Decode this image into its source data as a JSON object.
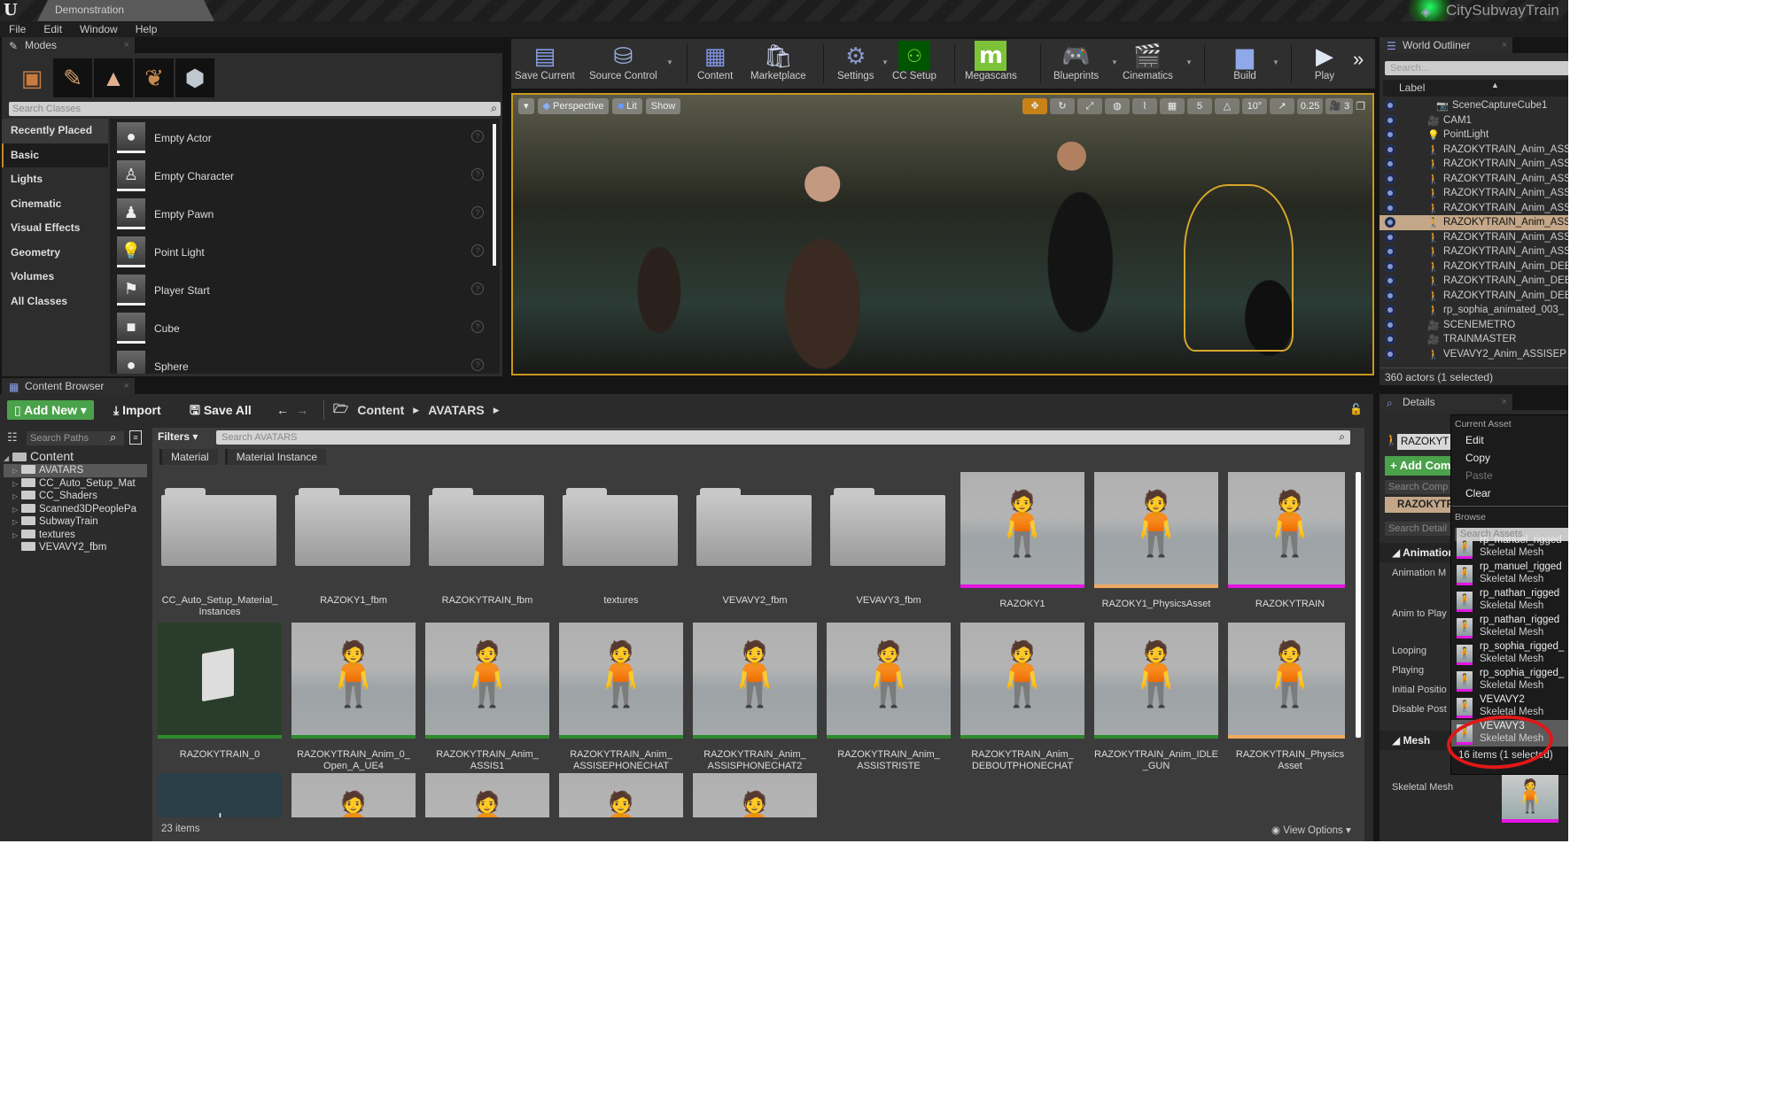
{
  "window": {
    "logo": "U",
    "doc_tab": "Demonstration",
    "project_name": "CitySubwayTrain"
  },
  "menubar": [
    "File",
    "Edit",
    "Window",
    "Help"
  ],
  "modes": {
    "tab_label": "Modes",
    "mode_icons": [
      "place-mode-icon",
      "paint-mode-icon",
      "landscape-mode-icon",
      "foliage-mode-icon",
      "geometry-mode-icon"
    ],
    "search_placeholder": "Search Classes",
    "categories": [
      "Recently Placed",
      "Basic",
      "Lights",
      "Cinematic",
      "Visual Effects",
      "Geometry",
      "Volumes",
      "All Classes"
    ],
    "active_category": "Basic",
    "items": [
      {
        "label": "Empty Actor",
        "icon": "●"
      },
      {
        "label": "Empty Character",
        "icon": "♙"
      },
      {
        "label": "Empty Pawn",
        "icon": "♟"
      },
      {
        "label": "Point Light",
        "icon": "💡"
      },
      {
        "label": "Player Start",
        "icon": "⚑"
      },
      {
        "label": "Cube",
        "icon": "■"
      },
      {
        "label": "Sphere",
        "icon": "●"
      }
    ]
  },
  "toolbar": {
    "buttons": [
      {
        "label": "Save Current",
        "icon": "💾"
      },
      {
        "label": "Source Control",
        "icon": "🗂"
      },
      {
        "label": "Content",
        "icon": "▦"
      },
      {
        "label": "Marketplace",
        "icon": "🛍"
      },
      {
        "label": "Settings",
        "icon": "⚙"
      },
      {
        "label": "CC Setup",
        "icon": "👥"
      },
      {
        "label": "Megascans",
        "icon": "m"
      },
      {
        "label": "Blueprints",
        "icon": "🎮"
      },
      {
        "label": "Cinematics",
        "icon": "🎬"
      },
      {
        "label": "Build",
        "icon": "▆"
      },
      {
        "label": "Play",
        "icon": "▶"
      }
    ],
    "overflow": "»"
  },
  "viewport": {
    "menu_arrow": "▾",
    "view_mode": "Perspective",
    "lighting": "Lit",
    "show": "Show",
    "grid_snap": "5",
    "rotation_snap": "10°",
    "scale_snap": "0.25",
    "camera_speed": "3"
  },
  "outliner": {
    "tab_label": "World Outliner",
    "search_placeholder": "Search...",
    "column_label": "Label",
    "rows": [
      {
        "label": "SceneCaptureCube1",
        "icon": "📷",
        "indent": true
      },
      {
        "label": "CAM1",
        "icon": "🎥"
      },
      {
        "label": "PointLight",
        "icon": "💡"
      },
      {
        "label": "RAZOKYTRAIN_Anim_ASS",
        "icon": "🚶"
      },
      {
        "label": "RAZOKYTRAIN_Anim_ASS",
        "icon": "🚶"
      },
      {
        "label": "RAZOKYTRAIN_Anim_ASS",
        "icon": "🚶"
      },
      {
        "label": "RAZOKYTRAIN_Anim_ASS",
        "icon": "🚶"
      },
      {
        "label": "RAZOKYTRAIN_Anim_ASS",
        "icon": "🚶"
      },
      {
        "label": "RAZOKYTRAIN_Anim_ASS",
        "icon": "🚶",
        "selected": true
      },
      {
        "label": "RAZOKYTRAIN_Anim_ASS",
        "icon": "🚶"
      },
      {
        "label": "RAZOKYTRAIN_Anim_ASS",
        "icon": "🚶"
      },
      {
        "label": "RAZOKYTRAIN_Anim_DEE",
        "icon": "🚶"
      },
      {
        "label": "RAZOKYTRAIN_Anim_DEE",
        "icon": "🚶"
      },
      {
        "label": "RAZOKYTRAIN_Anim_DEE",
        "icon": "🚶"
      },
      {
        "label": "rp_sophia_animated_003_",
        "icon": "🚶"
      },
      {
        "label": "SCENEMETRO",
        "icon": "🎥"
      },
      {
        "label": "TRAINMASTER",
        "icon": "🎥"
      },
      {
        "label": "VEVAVY2_Anim_ASSISEP",
        "icon": "🚶"
      }
    ],
    "status": "360 actors (1 selected)"
  },
  "content_browser": {
    "tab_label": "Content Browser",
    "add_new": "Add New ▾",
    "import": "Import",
    "save_all": "Save All",
    "breadcrumb": [
      "Content",
      "AVATARS"
    ],
    "paths_search_placeholder": "Search Paths",
    "tree": {
      "root": "Content",
      "children": [
        "AVATARS",
        "CC_Auto_Setup_Mat",
        "CC_Shaders",
        "Scanned3DPeoplePa",
        "SubwayTrain",
        "textures",
        "VEVAVY2_fbm"
      ],
      "selected": "AVATARS"
    },
    "filters_label": "Filters ▾",
    "search_placeholder": "Search AVATARS",
    "filter_tags": [
      "Material",
      "Material Instance"
    ],
    "assets": [
      {
        "name": "CC_Auto_Setup_Material_ Instances",
        "kind": "folder"
      },
      {
        "name": "RAZOKY1_fbm",
        "kind": "folder"
      },
      {
        "name": "RAZOKYTRAIN_fbm",
        "kind": "folder"
      },
      {
        "name": "textures",
        "kind": "folder"
      },
      {
        "name": "VEVAVY2_fbm",
        "kind": "folder"
      },
      {
        "name": "VEVAVY3_fbm",
        "kind": "folder"
      },
      {
        "name": "RAZOKY1",
        "kind": "mesh",
        "bar": "magenta"
      },
      {
        "name": "RAZOKY1_PhysicsAsset",
        "kind": "mesh",
        "bar": "orange"
      },
      {
        "name": "RAZOKYTRAIN",
        "kind": "mesh",
        "bar": "magenta"
      },
      {
        "name": "RAZOKYTRAIN_0",
        "kind": "material",
        "bar": "green"
      },
      {
        "name": "RAZOKYTRAIN_Anim_0_ Open_A_UE4",
        "kind": "mesh",
        "bar": "green"
      },
      {
        "name": "RAZOKYTRAIN_Anim_ ASSIS1",
        "kind": "mesh",
        "bar": "green"
      },
      {
        "name": "RAZOKYTRAIN_Anim_ ASSISEPHONECHAT",
        "kind": "mesh",
        "bar": "green"
      },
      {
        "name": "RAZOKYTRAIN_Anim_ ASSISPHONECHAT2",
        "kind": "mesh",
        "bar": "green"
      },
      {
        "name": "RAZOKYTRAIN_Anim_ ASSISTRISTE",
        "kind": "mesh",
        "bar": "green"
      },
      {
        "name": "RAZOKYTRAIN_Anim_ DEBOUTPHONECHAT",
        "kind": "mesh",
        "bar": "green"
      },
      {
        "name": "RAZOKYTRAIN_Anim_IDLE _GUN",
        "kind": "mesh",
        "bar": "green"
      },
      {
        "name": "RAZOKYTRAIN_Physics Asset",
        "kind": "mesh",
        "bar": "orange"
      },
      {
        "name": "",
        "kind": "skeleton"
      },
      {
        "name": "",
        "kind": "mesh",
        "female": true
      },
      {
        "name": "",
        "kind": "mesh",
        "female": true
      },
      {
        "name": "",
        "kind": "mesh",
        "female": true
      },
      {
        "name": "",
        "kind": "mesh",
        "female": true
      }
    ],
    "status": "23 items",
    "view_options": "View Options ▾"
  },
  "details": {
    "tab_label": "Details",
    "actor_name": "RAZOKYT",
    "add_component": "+ Add Com",
    "search_components_placeholder": "Search Comp",
    "component": "RAZOKYTR",
    "search_details_placeholder": "Search Detail",
    "categories": [
      {
        "label": "Animation",
        "props": [
          "Animation M",
          "Anim to Play",
          "Looping",
          "Playing",
          "Initial Positio",
          "Disable Post"
        ]
      },
      {
        "label": "Mesh",
        "props": [
          "Skeletal Mesh"
        ]
      }
    ]
  },
  "asset_picker": {
    "current_asset_header": "Current Asset",
    "actions": [
      {
        "label": "Edit",
        "enabled": true
      },
      {
        "label": "Copy",
        "enabled": true
      },
      {
        "label": "Paste",
        "enabled": false
      },
      {
        "label": "Clear",
        "enabled": true
      }
    ],
    "browse_header": "Browse",
    "search_placeholder": "Search Assets",
    "assets": [
      {
        "name": "rp_manuel_rigged",
        "type": "Skeletal Mesh"
      },
      {
        "name": "rp_manuel_rigged",
        "type": "Skeletal Mesh"
      },
      {
        "name": "rp_nathan_rigged",
        "type": "Skeletal Mesh"
      },
      {
        "name": "rp_nathan_rigged",
        "type": "Skeletal Mesh"
      },
      {
        "name": "rp_sophia_rigged_",
        "type": "Skeletal Mesh"
      },
      {
        "name": "rp_sophia_rigged_",
        "type": "Skeletal Mesh"
      },
      {
        "name": "VEVAVY2",
        "type": "Skeletal Mesh"
      },
      {
        "name": "VEVAVY3",
        "type": "Skeletal Mesh",
        "selected": true
      }
    ],
    "footer": "16 items (1 selected)"
  },
  "colors": {
    "accent_orange": "#c8961e",
    "add_green": "#4aa24a",
    "selection_tan": "#c3a788",
    "skeletal_mesh_bar": "#e414e4",
    "annotation_red": "#e01818"
  }
}
